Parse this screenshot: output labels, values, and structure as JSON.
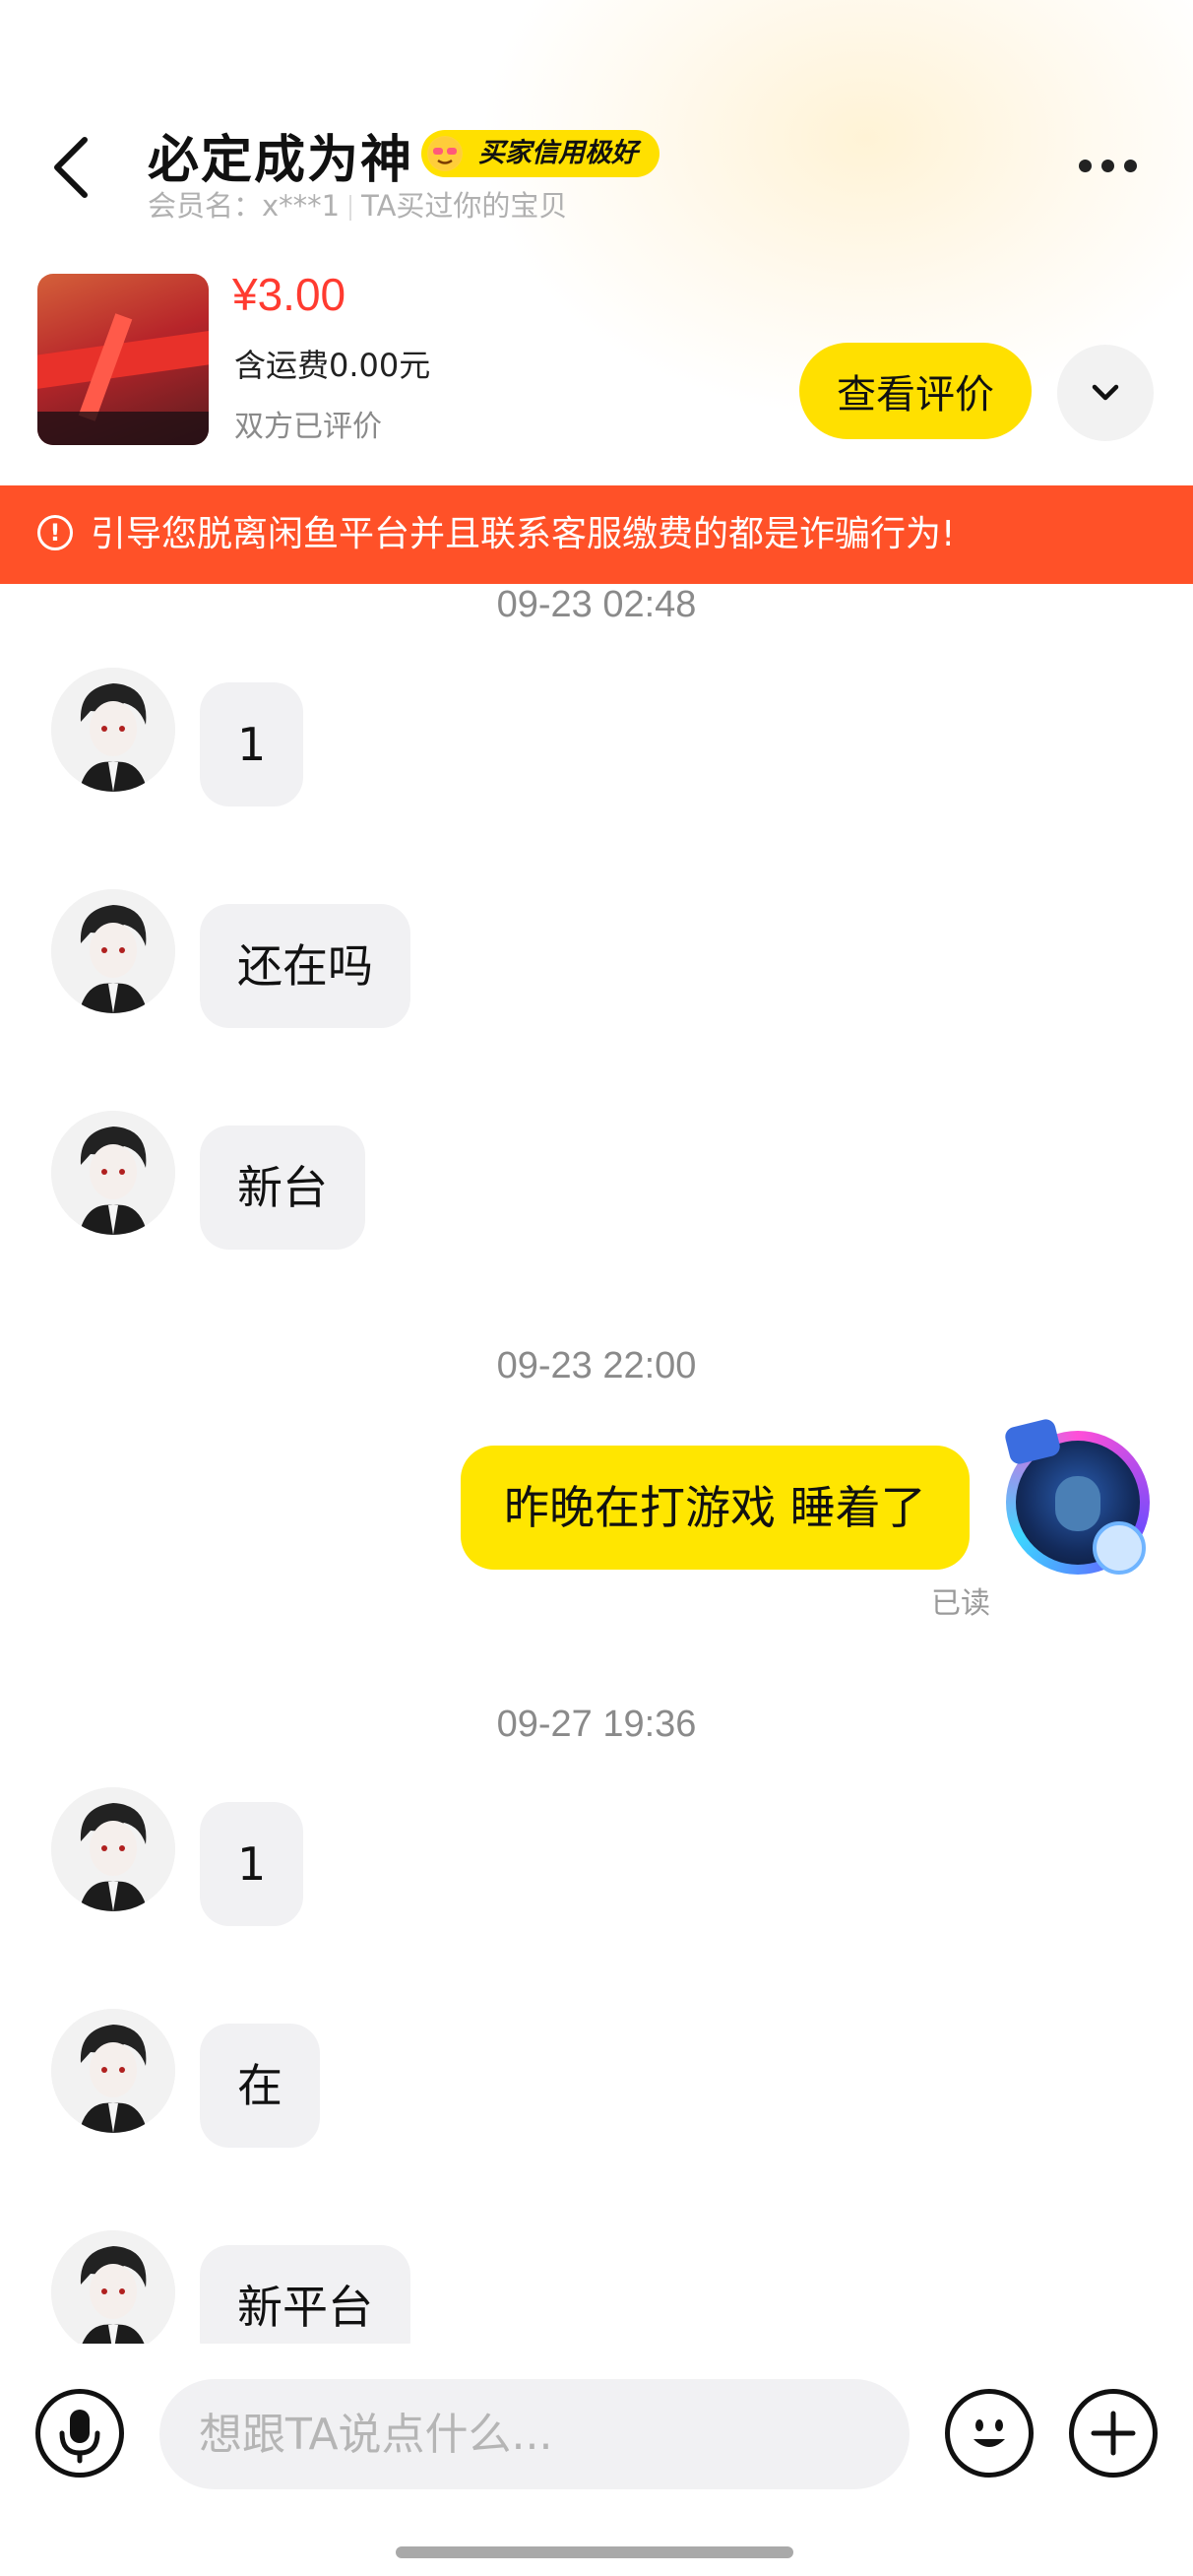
{
  "header": {
    "title": "必定成为神",
    "badge": "买家信用极好",
    "member_name": "会员名：x***1",
    "purchased_note": "TA买过你的宝贝"
  },
  "product": {
    "price": "¥3.00",
    "shipping": "含运费0.00元",
    "status": "双方已评价",
    "review_button": "查看评价"
  },
  "warning": {
    "text": "引导您脱离闲鱼平台并且联系客服缴费的都是诈骗行为!"
  },
  "messages": [
    {
      "type": "timestamp",
      "text": "09-23 02:48"
    },
    {
      "type": "incoming",
      "text": "1"
    },
    {
      "type": "incoming",
      "text": "还在吗"
    },
    {
      "type": "incoming",
      "text": "新台"
    },
    {
      "type": "timestamp",
      "text": "09-23 22:00"
    },
    {
      "type": "outgoing",
      "text": "昨晚在打游戏 睡着了",
      "status": "已读"
    },
    {
      "type": "timestamp",
      "text": "09-27 19:36"
    },
    {
      "type": "incoming",
      "text": "1"
    },
    {
      "type": "incoming",
      "text": "在"
    },
    {
      "type": "incoming",
      "text": "新平台"
    }
  ],
  "input": {
    "placeholder": "想跟TA说点什么..."
  },
  "icons": {
    "back": "back-arrow-icon",
    "more": "more-dots-icon",
    "expand": "chevron-down-icon",
    "warning": "exclamation-circle-icon",
    "voice": "microphone-icon",
    "emoji": "smiley-icon",
    "plus": "plus-icon"
  },
  "colors": {
    "accent_yellow": "#ffe000",
    "price_red": "#ff3b30",
    "warning_bg": "#ff5128",
    "incoming_bubble": "#f1f1f3"
  }
}
